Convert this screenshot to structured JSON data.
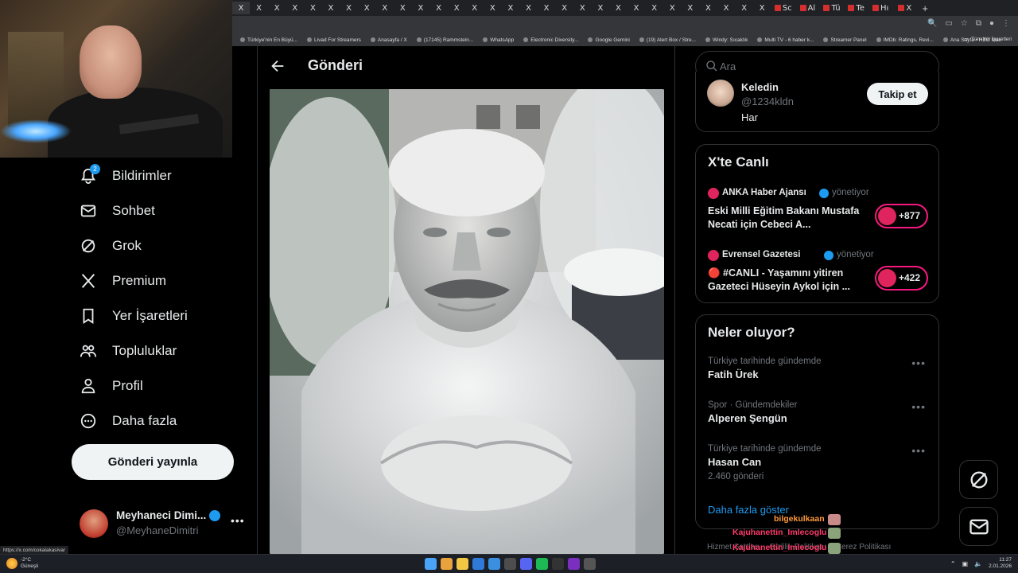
{
  "browser": {
    "tabs": [
      "X",
      "X",
      "X",
      "X",
      "X",
      "X",
      "X",
      "X",
      "X",
      "X",
      "X",
      "X",
      "X",
      "X",
      "X",
      "X",
      "X",
      "X",
      "X",
      "X",
      "X",
      "X",
      "X",
      "X",
      "X",
      "X",
      "X",
      "X",
      "X",
      "X"
    ],
    "tabs_right": [
      "Sc",
      "Al",
      "Tü",
      "Te",
      "Hı",
      "X"
    ],
    "bookmarks": [
      "Türkiye'nin En Büyü...",
      "Livad For Streamers",
      "Anasayfa / X",
      "(17145) Rammstein...",
      "WhatsApp",
      "Electronic Diversity...",
      "Google Gemini",
      "(19) Alert Box / Stre...",
      "Windy: Sıcaklık",
      "Multi TV - 6 haber k...",
      "Streamer Panel",
      "IMDb: Ratings, Revi...",
      "Ana Sayfa • HBO Max"
    ],
    "bookmarks_right": "Tüm Yer İşaretleri",
    "status_url": "https://x.com/cokalakasivar"
  },
  "nav": {
    "notifications_badge": "2",
    "items": [
      {
        "label": "Bildirimler",
        "icon": "bell-icon"
      },
      {
        "label": "Sohbet",
        "icon": "mail-icon"
      },
      {
        "label": "Grok",
        "icon": "grok-icon"
      },
      {
        "label": "Premium",
        "icon": "x-logo-icon"
      },
      {
        "label": "Yer İşaretleri",
        "icon": "bookmark-icon"
      },
      {
        "label": "Topluluklar",
        "icon": "communities-icon"
      },
      {
        "label": "Profil",
        "icon": "person-icon"
      },
      {
        "label": "Daha fazla",
        "icon": "more-circle-icon"
      }
    ],
    "post_button": "Gönderi yayınla"
  },
  "account": {
    "name": "Meyhaneci Dimi...",
    "handle": "@MeyhaneDimitri",
    "more": "•••"
  },
  "main": {
    "title": "Gönderi"
  },
  "search": {
    "placeholder": "Ara"
  },
  "follow_suggestion": {
    "name": "Keledin",
    "handle": "@1234kldn",
    "bio": "Har",
    "button": "Takip et"
  },
  "live": {
    "title": "X'te Canlı",
    "items": [
      {
        "source": "ANKA Haber Ajansı",
        "action": "yönetiyor",
        "title": "Eski Milli Eğitim Bakanı Mustafa Necati için Cebeci A...",
        "count": "+877",
        "color": "#e0245e"
      },
      {
        "source": "Evrensel Gazetesi",
        "action": "yönetiyor",
        "title": "🔴 #CANLI - Yaşamını yitiren Gazeteci Hüseyin Aykol için ...",
        "count": "+422",
        "color": "#e0245e"
      }
    ]
  },
  "trends": {
    "title": "Neler oluyor?",
    "items": [
      {
        "context": "Türkiye tarihinde gündemde",
        "name": "Fatih Ürek",
        "count": ""
      },
      {
        "context": "Spor · Gündemdekiler",
        "name": "Alperen Şengün",
        "count": ""
      },
      {
        "context": "Türkiye tarihinde gündemde",
        "name": "Hasan Can",
        "count": "2.460 gönderi"
      }
    ],
    "more_icon": "•••",
    "show_more": "Daha fazla göster"
  },
  "footer": {
    "links": [
      "Hizmet Şartları",
      "Gizlilik Politikası",
      "Çerez Politikası"
    ]
  },
  "chat": [
    {
      "user": "bilgekulkaan",
      "color": "#ff9a3c"
    },
    {
      "user": "Kajuhanettin_Imlecoglu",
      "color": "#ff3b6b"
    },
    {
      "user": "Kajuhanettin_Imlecoglu",
      "color": "#ff3b6b"
    }
  ],
  "overlay_size": "7_62x51",
  "taskbar": {
    "temp": "-2°C",
    "weather": "Güneşli",
    "time": "11:27",
    "date": "2.01.2026"
  },
  "colors": {
    "accent": "#1d9bf0",
    "live_pink": "#f91880"
  }
}
